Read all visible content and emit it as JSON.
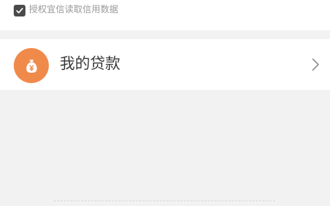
{
  "consent": {
    "label": "授权宜信读取信用数据",
    "checked": true
  },
  "menu": {
    "my_loans_label": "我的贷款",
    "icon": "money-bag-icon",
    "arrow_icon": "chevron-right-icon"
  },
  "colors": {
    "icon_bg": "#f08a4b",
    "checkbox_bg": "#4a4a4a",
    "page_bg": "#f2f2f2"
  }
}
